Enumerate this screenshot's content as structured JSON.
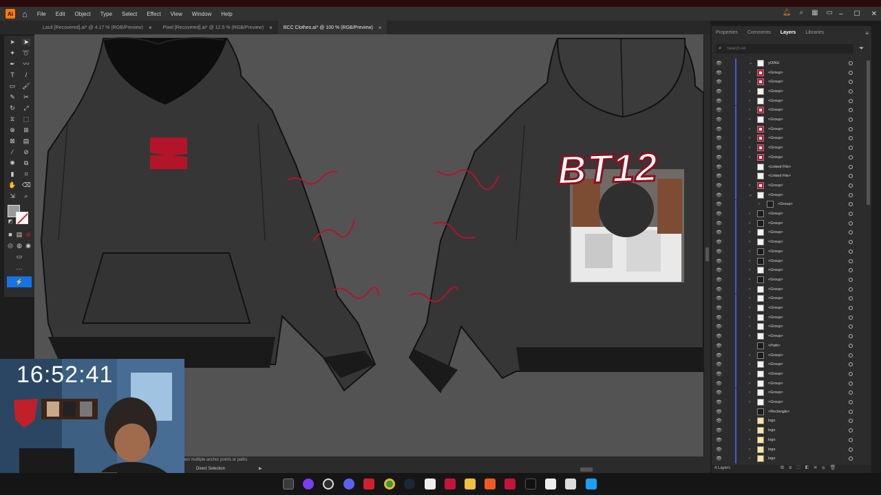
{
  "app": {
    "icon_label": "Ai"
  },
  "menu": [
    "File",
    "Edit",
    "Object",
    "Type",
    "Select",
    "Effect",
    "View",
    "Window",
    "Help"
  ],
  "tabs": [
    {
      "label": "Lauli [Recovered].ai* @ 4.17 % (RGB/Preview)",
      "active": false
    },
    {
      "label": "Pixel [Recovered].ai* @ 12.5 % (RGB/Preview)",
      "active": false
    },
    {
      "label": "BCC Clothes.ai* @ 100 % (RGB/Preview)",
      "active": true
    }
  ],
  "tab_close": "×",
  "panel": {
    "tabs": [
      "Properties",
      "Comments",
      "Layers",
      "Libraries"
    ],
    "active_tab": "Layers",
    "search_placeholder": "Search All",
    "footer_count": "4 Layers",
    "layers": [
      {
        "name": "yOINU",
        "chev": "v",
        "thumb": "white"
      },
      {
        "name": "<Group>",
        "chev": ">",
        "thumb": "red"
      },
      {
        "name": "<Group>",
        "chev": ">",
        "thumb": "red"
      },
      {
        "name": "<Group>",
        "chev": ">",
        "thumb": "white"
      },
      {
        "name": "<Group>",
        "chev": ">",
        "thumb": "white"
      },
      {
        "name": "<Group>",
        "chev": ">",
        "thumb": "red"
      },
      {
        "name": "<Group>",
        "chev": ">",
        "thumb": "white"
      },
      {
        "name": "<Group>",
        "chev": ">",
        "thumb": "red"
      },
      {
        "name": "<Group>",
        "chev": ">",
        "thumb": "red"
      },
      {
        "name": "<Group>",
        "chev": ">",
        "thumb": "red"
      },
      {
        "name": "<Group>",
        "chev": ">",
        "thumb": "red"
      },
      {
        "name": "<Linked File>",
        "chev": "",
        "thumb": "white"
      },
      {
        "name": "<Linked File>",
        "chev": "",
        "thumb": "white"
      },
      {
        "name": "<Group>",
        "chev": ">",
        "thumb": "red"
      },
      {
        "name": "<Group>",
        "chev": "v",
        "thumb": "white"
      },
      {
        "name": "<Group>",
        "chev": ">",
        "thumb": "dark",
        "indent": true
      },
      {
        "name": "<Group>",
        "chev": ">",
        "thumb": "dark"
      },
      {
        "name": "<Group>",
        "chev": ">",
        "thumb": "dark"
      },
      {
        "name": "<Group>",
        "chev": ">",
        "thumb": "white"
      },
      {
        "name": "<Group>",
        "chev": ">",
        "thumb": "white"
      },
      {
        "name": "<Group>",
        "chev": ">",
        "thumb": "dark"
      },
      {
        "name": "<Group>",
        "chev": ">",
        "thumb": "dark"
      },
      {
        "name": "<Group>",
        "chev": ">",
        "thumb": "white"
      },
      {
        "name": "<Group>",
        "chev": ">",
        "thumb": "dark"
      },
      {
        "name": "<Group>",
        "chev": ">",
        "thumb": "white"
      },
      {
        "name": "<Group>",
        "chev": ">",
        "thumb": "white"
      },
      {
        "name": "<Group>",
        "chev": ">",
        "thumb": "white"
      },
      {
        "name": "<Group>",
        "chev": ">",
        "thumb": "white"
      },
      {
        "name": "<Group>",
        "chev": ">",
        "thumb": "white"
      },
      {
        "name": "<Group>",
        "chev": ">",
        "thumb": "white"
      },
      {
        "name": "<Path>",
        "chev": "",
        "thumb": "dark"
      },
      {
        "name": "<Group>",
        "chev": ">",
        "thumb": "dark"
      },
      {
        "name": "<Group>",
        "chev": ">",
        "thumb": "white"
      },
      {
        "name": "<Group>",
        "chev": ">",
        "thumb": "white"
      },
      {
        "name": "<Group>",
        "chev": ">",
        "thumb": "white"
      },
      {
        "name": "<Group>",
        "chev": ">",
        "thumb": "white"
      },
      {
        "name": "<Group>",
        "chev": ">",
        "thumb": "white"
      },
      {
        "name": "<Rectangle>",
        "chev": "",
        "thumb": "dark"
      },
      {
        "name": "logo",
        "chev": ">",
        "thumb": "yellow"
      },
      {
        "name": "logo",
        "chev": ">",
        "thumb": "yellow"
      },
      {
        "name": "logo",
        "chev": ">",
        "thumb": "yellow"
      },
      {
        "name": "logo",
        "chev": ">",
        "thumb": "yellow"
      },
      {
        "name": "logo",
        "chev": ">",
        "thumb": "yellow"
      }
    ]
  },
  "status": {
    "hint": "ect multiple anchor points or paths",
    "tool": "Direct Selection"
  },
  "artwork": {
    "back_print_text": "BT12"
  },
  "clock": "16:52:41",
  "colors": {
    "accent_blue": "#1473e6",
    "hoodie": "#353535",
    "print_red": "#c8102e"
  }
}
